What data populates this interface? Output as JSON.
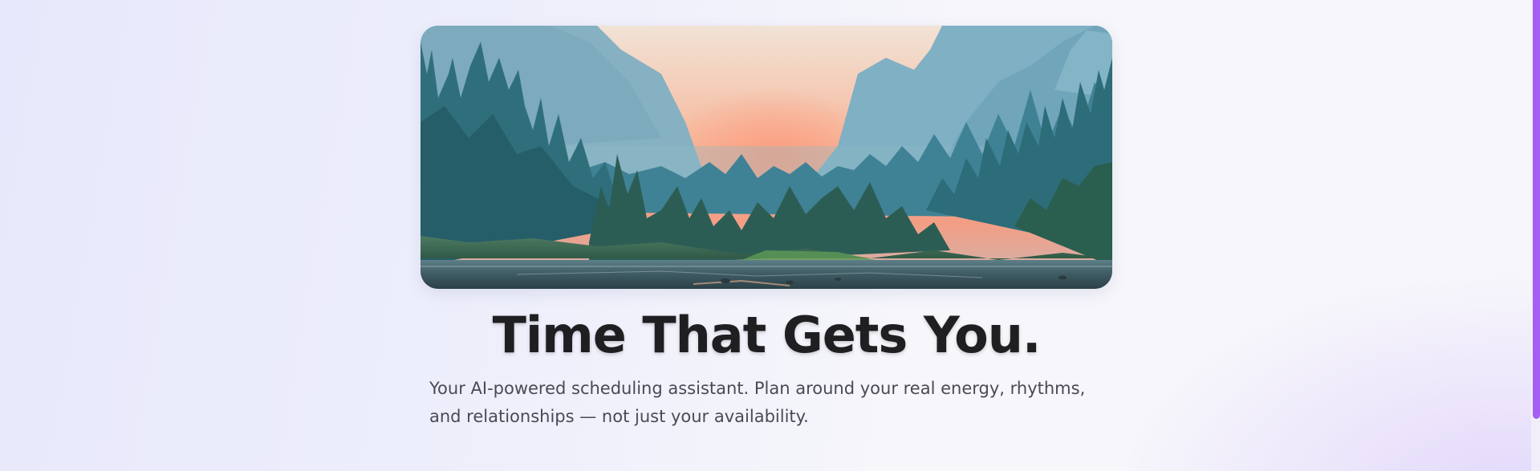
{
  "hero": {
    "image_alt": "Forest valley landscape at sunrise with mountains, pine trees and a river",
    "title": "Time That Gets You.",
    "subtitle": "Your AI-powered scheduling assistant. Plan around your real energy, rhythms, and relationships — not just your availability."
  },
  "colors": {
    "accent": "#a55ef3",
    "title": "#1f1f22",
    "body_text": "#4a4a55"
  }
}
